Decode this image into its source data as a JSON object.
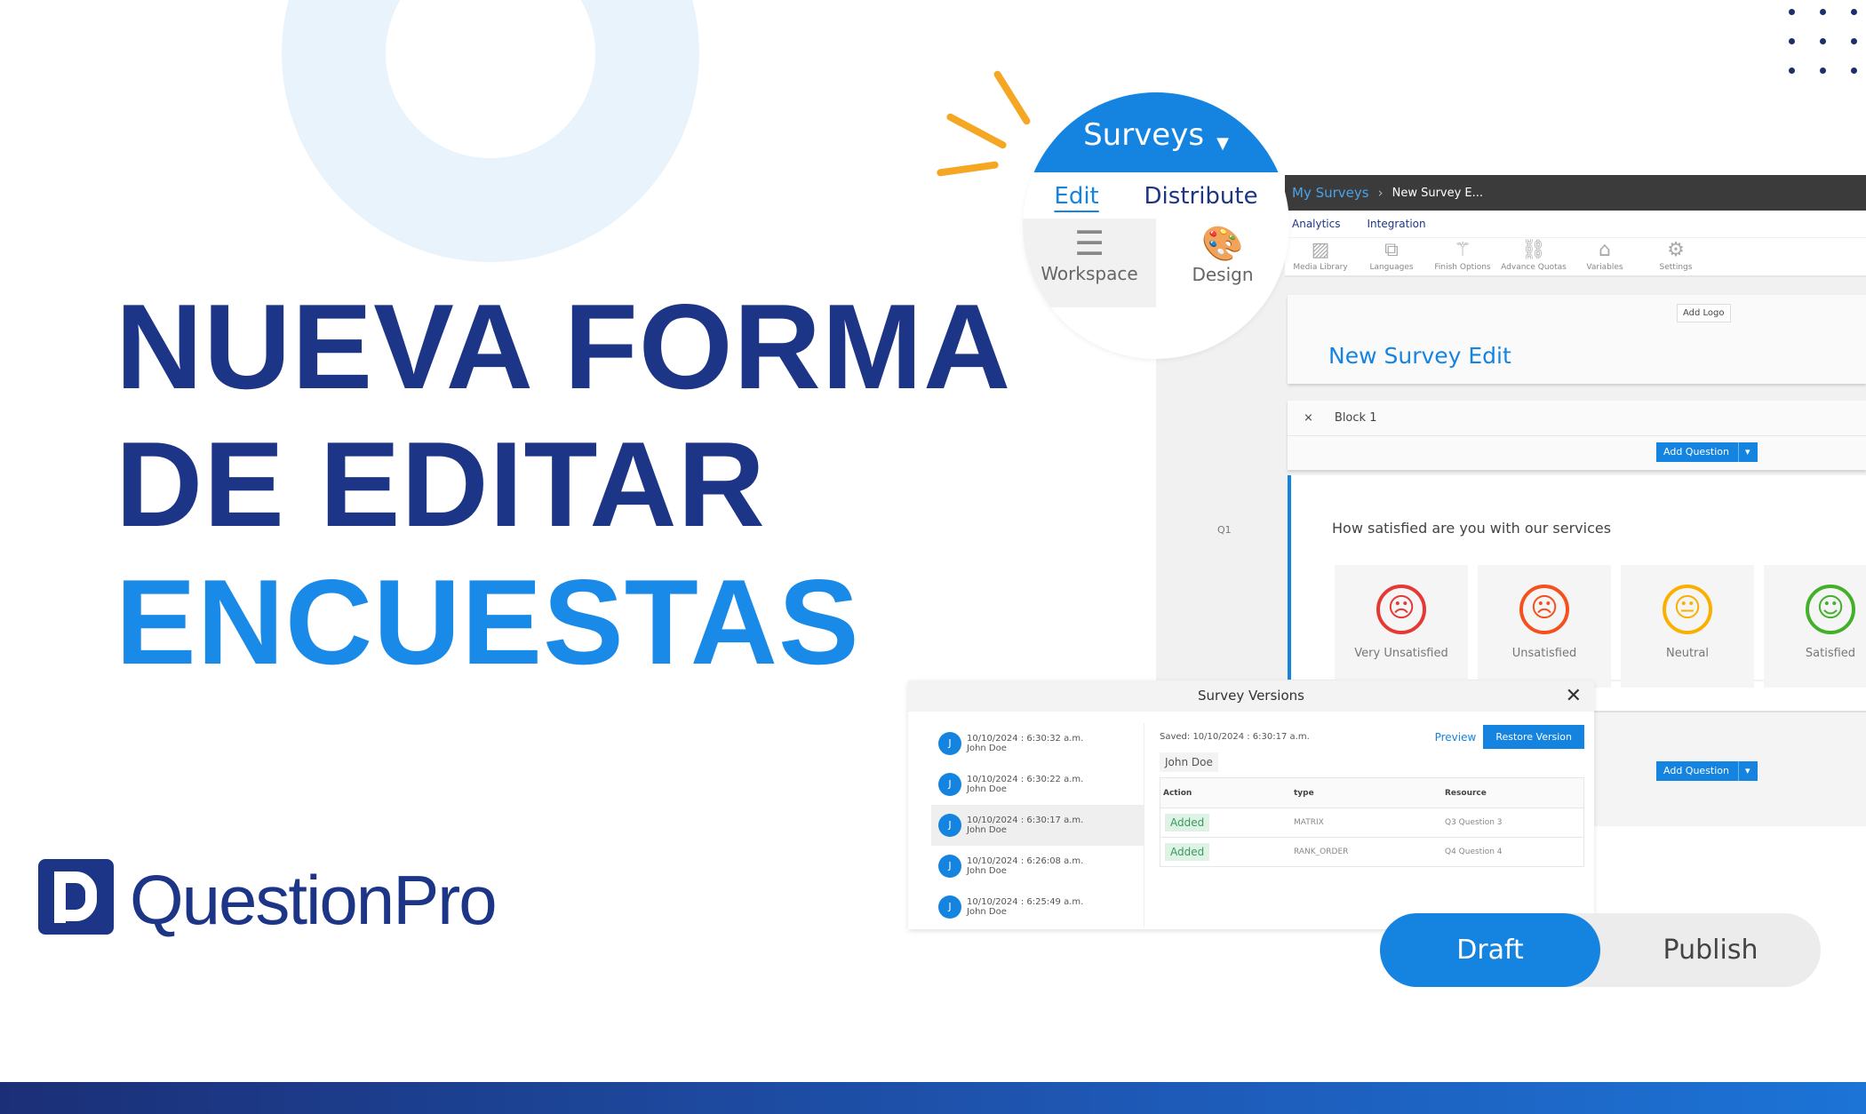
{
  "headline": {
    "line1": "NUEVA FORMA",
    "line2": "DE EDITAR",
    "line3": "ENCUESTAS"
  },
  "brand": {
    "name": "QuestionPro",
    "logo_letter": "P",
    "navy": "#1d3586",
    "blue": "#1a8ae8"
  },
  "surveys_menu": {
    "title": "Surveys",
    "tabs": [
      "Edit",
      "Distribute"
    ],
    "tools": [
      {
        "label": "Workspace",
        "icon": "list-icon"
      },
      {
        "label": "Design",
        "icon": "palette-icon"
      }
    ]
  },
  "app": {
    "breadcrumb": {
      "root": "My Surveys",
      "current": "New Survey E..."
    },
    "tabs": [
      "Analytics",
      "Integration"
    ],
    "toolbar": [
      {
        "label": "Media Library",
        "icon": "image-icon"
      },
      {
        "label": "Languages",
        "icon": "translate-icon"
      },
      {
        "label": "Finish Options",
        "icon": "wand-icon"
      },
      {
        "label": "Advance Quotas",
        "icon": "link-icon"
      },
      {
        "label": "Variables",
        "icon": "tag-icon"
      },
      {
        "label": "Settings",
        "icon": "gear-icon"
      }
    ],
    "add_logo": "Add Logo",
    "survey_title": "New Survey Edit",
    "block": "Block 1",
    "add_question": "Add Question",
    "question_number": "Q1",
    "question_text": "How satisfied are you with our services",
    "options": [
      {
        "label": "Very Unsatisfied",
        "color": "#e53935"
      },
      {
        "label": "Unsatisfied",
        "color": "#f4511e"
      },
      {
        "label": "Neutral",
        "color": "#f9b000"
      },
      {
        "label": "Satisfied",
        "color": "#43b02a"
      }
    ]
  },
  "versions": {
    "title": "Survey Versions",
    "items": [
      {
        "time": "10/10/2024 : 6:30:32 a.m.",
        "user": "John Doe",
        "initial": "J"
      },
      {
        "time": "10/10/2024 : 6:30:22 a.m.",
        "user": "John Doe",
        "initial": "J"
      },
      {
        "time": "10/10/2024 : 6:30:17 a.m.",
        "user": "John Doe",
        "initial": "J"
      },
      {
        "time": "10/10/2024 : 6:26:08 a.m.",
        "user": "John Doe",
        "initial": "J"
      },
      {
        "time": "10/10/2024 : 6:25:49 a.m.",
        "user": "John Doe",
        "initial": "J"
      }
    ],
    "saved": "Saved: 10/10/2024 : 6:30:17 a.m.",
    "preview": "Preview",
    "restore": "Restore Version",
    "user_chip": "John Doe",
    "columns": [
      "Action",
      "type",
      "Resource"
    ],
    "rows": [
      {
        "action": "Added",
        "type": "MATRIX",
        "resource": "Q3 Question 3"
      },
      {
        "action": "Added",
        "type": "RANK_ORDER",
        "resource": "Q4 Question 4"
      }
    ]
  },
  "toggle": {
    "draft": "Draft",
    "publish": "Publish",
    "selected": "Draft"
  }
}
